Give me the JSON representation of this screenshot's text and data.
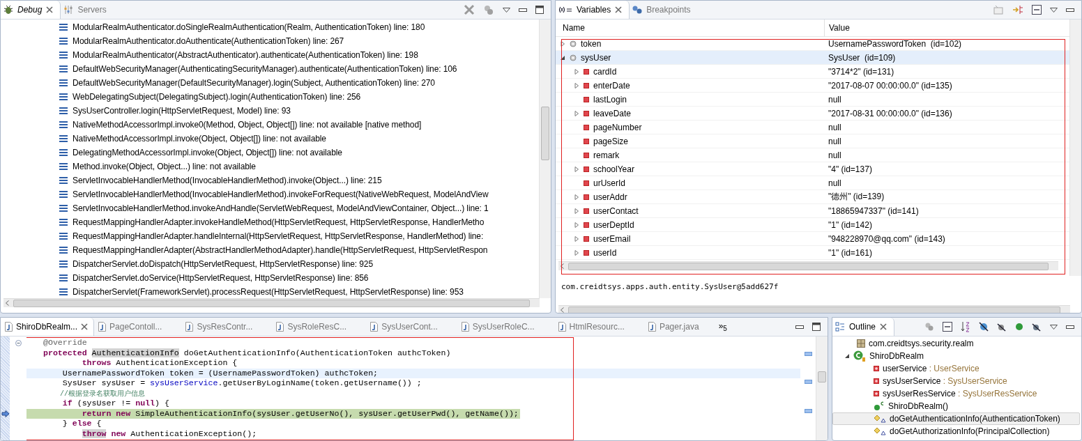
{
  "debug": {
    "tabs": [
      {
        "label": "Debug",
        "kind": "debug",
        "selected": true
      },
      {
        "label": "Servers",
        "kind": "servers",
        "selected": false
      }
    ],
    "frames": [
      "ModularRealmAuthenticator.doSingleRealmAuthentication(Realm, AuthenticationToken) line: 180",
      "ModularRealmAuthenticator.doAuthenticate(AuthenticationToken) line: 267",
      "ModularRealmAuthenticator(AbstractAuthenticator).authenticate(AuthenticationToken) line: 198",
      "DefaultWebSecurityManager(AuthenticatingSecurityManager).authenticate(AuthenticationToken) line: 106",
      "DefaultWebSecurityManager(DefaultSecurityManager).login(Subject, AuthenticationToken) line: 270",
      "WebDelegatingSubject(DelegatingSubject).login(AuthenticationToken) line: 256",
      "SysUserController.login(HttpServletRequest, Model) line: 93",
      "NativeMethodAccessorImpl.invoke0(Method, Object, Object[]) line: not available [native method]",
      "NativeMethodAccessorImpl.invoke(Object, Object[]) line: not available",
      "DelegatingMethodAccessorImpl.invoke(Object, Object[]) line: not available",
      "Method.invoke(Object, Object...) line: not available",
      "ServletInvocableHandlerMethod(InvocableHandlerMethod).invoke(Object...) line: 215",
      "ServletInvocableHandlerMethod(InvocableHandlerMethod).invokeForRequest(NativeWebRequest, ModelAndView",
      "ServletInvocableHandlerMethod.invokeAndHandle(ServletWebRequest, ModelAndViewContainer, Object...) line: 1",
      "RequestMappingHandlerAdapter.invokeHandleMethod(HttpServletRequest, HttpServletResponse, HandlerMetho",
      "RequestMappingHandlerAdapter.handleInternal(HttpServletRequest, HttpServletResponse, HandlerMethod) line:",
      "RequestMappingHandlerAdapter(AbstractHandlerMethodAdapter).handle(HttpServletRequest, HttpServletRespon",
      "DispatcherServlet.doDispatch(HttpServletRequest, HttpServletResponse) line: 925",
      "DispatcherServlet.doService(HttpServletRequest, HttpServletResponse) line: 856",
      "DispatcherServlet(FrameworkServlet).processRequest(HttpServletRequest, HttpServletResponse) line: 953"
    ]
  },
  "variables": {
    "tabs": [
      {
        "label": "Variables",
        "kind": "variables",
        "selected": true
      },
      {
        "label": "Breakpoints",
        "kind": "breakpoints",
        "selected": false
      }
    ],
    "columns": [
      "Name",
      "Value"
    ],
    "rows": [
      {
        "name": "token",
        "value": "UsernamePasswordToken  (id=102)",
        "kind": "local",
        "expandable": true,
        "expanded": false,
        "selected": false
      },
      {
        "name": "sysUser",
        "value": "SysUser  (id=109)",
        "kind": "local",
        "expandable": true,
        "expanded": true,
        "selected": true,
        "children": [
          {
            "name": "cardId",
            "value": "\"3714*2\" (id=131)",
            "kind": "field",
            "expandable": true,
            "expanded": false,
            "selected": false
          },
          {
            "name": "enterDate",
            "value": "\"2017-08-07 00:00:00.0\" (id=135)",
            "kind": "field",
            "expandable": true,
            "expanded": false,
            "selected": false
          },
          {
            "name": "lastLogin",
            "value": "null",
            "kind": "field",
            "expandable": false,
            "expanded": false,
            "selected": false
          },
          {
            "name": "leaveDate",
            "value": "\"2017-08-31 00:00:00.0\" (id=136)",
            "kind": "field",
            "expandable": true,
            "expanded": false,
            "selected": false
          },
          {
            "name": "pageNumber",
            "value": "null",
            "kind": "field",
            "expandable": false,
            "expanded": false,
            "selected": false
          },
          {
            "name": "pageSize",
            "value": "null",
            "kind": "field",
            "expandable": false,
            "expanded": false,
            "selected": false
          },
          {
            "name": "remark",
            "value": "null",
            "kind": "field",
            "expandable": false,
            "expanded": false,
            "selected": false
          },
          {
            "name": "schoolYear",
            "value": "\"4\" (id=137)",
            "kind": "field",
            "expandable": true,
            "expanded": false,
            "selected": false
          },
          {
            "name": "urUserId",
            "value": "null",
            "kind": "field",
            "expandable": false,
            "expanded": false,
            "selected": false
          },
          {
            "name": "userAddr",
            "value": "\"德州\" (id=139)",
            "kind": "field",
            "expandable": true,
            "expanded": false,
            "selected": false
          },
          {
            "name": "userContact",
            "value": "\"18865947337\" (id=141)",
            "kind": "field",
            "expandable": true,
            "expanded": false,
            "selected": false
          },
          {
            "name": "userDeptId",
            "value": "\"1\" (id=142)",
            "kind": "field",
            "expandable": true,
            "expanded": false,
            "selected": false
          },
          {
            "name": "userEmail",
            "value": "\"948228970@qq.com\" (id=143)",
            "kind": "field",
            "expandable": true,
            "expanded": false,
            "selected": false
          },
          {
            "name": "userId",
            "value": "\"1\" (id=161)",
            "kind": "field",
            "expandable": true,
            "expanded": false,
            "selected": false
          }
        ]
      }
    ],
    "detail": "com.creidtsys.apps.auth.entity.SysUser@5add627f"
  },
  "editor": {
    "tabs": [
      {
        "label": "ShiroDbRealm...",
        "selected": true
      },
      {
        "label": "PageContoll...",
        "selected": false
      },
      {
        "label": "SysResContr...",
        "selected": false
      },
      {
        "label": "SysRoleResC...",
        "selected": false
      },
      {
        "label": "SysUserCont...",
        "selected": false
      },
      {
        "label": "SysUserRoleC...",
        "selected": false
      },
      {
        "label": "HtmlResourc...",
        "selected": false
      },
      {
        "label": "Pager.java",
        "selected": false
      }
    ],
    "more_tabs": "»$_{5}$",
    "lines": [
      {
        "cursor_line": false,
        "current_line": false,
        "fold": true,
        "pointer": false,
        "tokens": [
          {
            "t": "@Override",
            "kind": "annotation"
          }
        ]
      },
      {
        "cursor_line": false,
        "current_line": false,
        "fold": false,
        "pointer": false,
        "tokens": [
          {
            "t": "protected ",
            "kind": "keyword"
          },
          {
            "t": "AuthenticationInfo",
            "kind": "occurrence"
          },
          {
            "t": " doGetAuthenticationInfo(AuthenticationToken authcToken)",
            "kind": "plain"
          }
        ]
      },
      {
        "cursor_line": false,
        "current_line": false,
        "fold": false,
        "pointer": false,
        "tokens": [
          {
            "t": "        throws",
            "kind": "keyword"
          },
          {
            "t": " AuthenticationException {",
            "kind": "plain"
          }
        ]
      },
      {
        "cursor_line": true,
        "current_line": false,
        "fold": false,
        "pointer": false,
        "tokens": [
          {
            "t": "    UsernamePasswordToken token = (UsernamePasswordToken) authcToken;",
            "kind": "plain"
          }
        ]
      },
      {
        "cursor_line": false,
        "current_line": false,
        "fold": false,
        "pointer": false,
        "tokens": [
          {
            "t": "    SysUser sysUser = ",
            "kind": "plain"
          },
          {
            "t": "sysUserService",
            "kind": "field"
          },
          {
            "t": ".getUserByLoginName(token.getUsername()) ;",
            "kind": "plain"
          }
        ]
      },
      {
        "cursor_line": false,
        "current_line": false,
        "fold": false,
        "pointer": false,
        "tokens": [
          {
            "t": "    //根据登录名获取用户信息",
            "kind": "comment"
          }
        ]
      },
      {
        "cursor_line": false,
        "current_line": false,
        "fold": false,
        "pointer": false,
        "tokens": [
          {
            "t": "    if",
            "kind": "keyword"
          },
          {
            "t": " (sysUser != ",
            "kind": "plain"
          },
          {
            "t": "null",
            "kind": "keyword"
          },
          {
            "t": ") {",
            "kind": "plain"
          }
        ]
      },
      {
        "cursor_line": false,
        "current_line": true,
        "fold": false,
        "pointer": true,
        "tokens": [
          {
            "t": "        return new",
            "kind": "keyword"
          },
          {
            "t": " SimpleAuthenticationInfo(sysUser.getUserNo(), sysUser.getUserPwd(), getName());",
            "kind": "plain"
          }
        ]
      },
      {
        "cursor_line": false,
        "current_line": false,
        "fold": false,
        "pointer": false,
        "tokens": [
          {
            "t": "    } ",
            "kind": "plain"
          },
          {
            "t": "else",
            "kind": "keyword"
          },
          {
            "t": " {",
            "kind": "plain"
          }
        ]
      },
      {
        "cursor_line": false,
        "current_line": false,
        "fold": false,
        "pointer": false,
        "tokens": [
          {
            "t": "        throw",
            "kind": "keyword-occurrence"
          },
          {
            "t": " new",
            "kind": "keyword"
          },
          {
            "t": " AuthenticationException();",
            "kind": "plain"
          }
        ]
      }
    ]
  },
  "outline": {
    "tab": {
      "label": "Outline",
      "selected": true
    },
    "items": [
      {
        "name": "com.creidtsys.security.realm",
        "kind": "package",
        "selected": false
      },
      {
        "name": "ShiroDbRealm",
        "kind": "class",
        "selected": false,
        "expanded": true,
        "children": [
          {
            "name": "userService",
            "type": " : UserService",
            "kind": "field",
            "selected": false
          },
          {
            "name": "sysUserService",
            "type": " : SysUserService",
            "kind": "field",
            "selected": false
          },
          {
            "name": "sysUserResService",
            "type": " : SysUserResService",
            "kind": "field",
            "selected": false
          },
          {
            "name": "ShiroDbRealm()",
            "kind": "constructor",
            "selected": false
          },
          {
            "name": "doGetAuthenticationInfo(AuthenticationToken)",
            "kind": "method",
            "selected": true
          },
          {
            "name": "doGetAuthorizationInfo(PrincipalCollection)",
            "kind": "method",
            "selected": false
          }
        ]
      }
    ]
  }
}
